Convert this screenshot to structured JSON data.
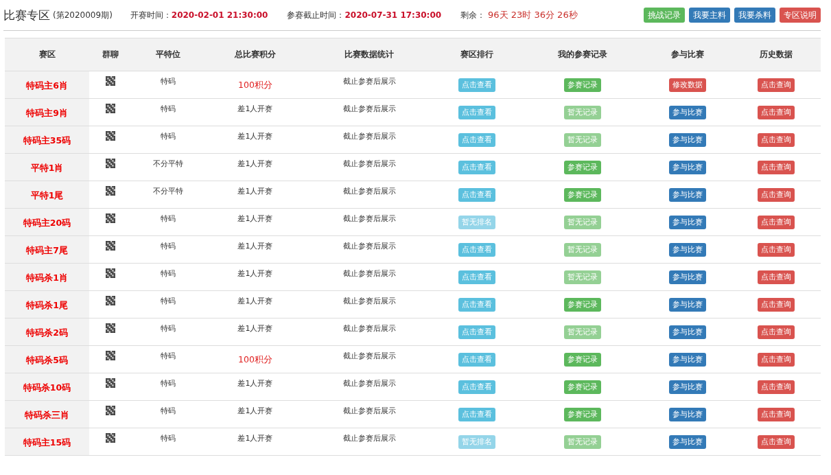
{
  "header": {
    "title": "比赛专区",
    "period": "(第2020009期)",
    "start_label": "开赛时间：",
    "start_value": "2020-02-01 21:30:00",
    "deadline_label": "参赛截止时间：",
    "deadline_value": "2020-07-31 17:30:00",
    "remaining_label": "剩余：",
    "remaining_value": "96天 23时 36分 26秒",
    "buttons": [
      {
        "label": "挑战记录",
        "kind": "success"
      },
      {
        "label": "我要主料",
        "kind": "primary"
      },
      {
        "label": "我要杀料",
        "kind": "primary"
      },
      {
        "label": "专区说明",
        "kind": "danger"
      }
    ]
  },
  "table": {
    "columns": [
      "赛区",
      "群聊",
      "平特位",
      "总比赛积分",
      "比赛数据统计",
      "赛区排行",
      "我的参赛记录",
      "参与比赛",
      "历史数据"
    ],
    "rows": [
      {
        "zone": "特码主6肖",
        "position": "特码",
        "score": "100积分",
        "score_highlight": true,
        "stats": "截止参赛后展示",
        "rank": {
          "label": "点击查看",
          "disabled": false
        },
        "record": {
          "label": "参赛记录",
          "disabled": false
        },
        "join": {
          "label": "修改数据",
          "kind": "modify"
        },
        "history": "点击查询"
      },
      {
        "zone": "特码主9肖",
        "position": "特码",
        "score": "差1人开赛",
        "score_highlight": false,
        "stats": "截止参赛后展示",
        "rank": {
          "label": "点击查看",
          "disabled": false
        },
        "record": {
          "label": "暂无记录",
          "disabled": true
        },
        "join": {
          "label": "参与比赛",
          "kind": "join"
        },
        "history": "点击查询"
      },
      {
        "zone": "特码主35码",
        "position": "特码",
        "score": "差1人开赛",
        "score_highlight": false,
        "stats": "截止参赛后展示",
        "rank": {
          "label": "点击查看",
          "disabled": false
        },
        "record": {
          "label": "暂无记录",
          "disabled": true
        },
        "join": {
          "label": "参与比赛",
          "kind": "join"
        },
        "history": "点击查询"
      },
      {
        "zone": "平特1肖",
        "position": "不分平特",
        "score": "差1人开赛",
        "score_highlight": false,
        "stats": "截止参赛后展示",
        "rank": {
          "label": "点击查看",
          "disabled": false
        },
        "record": {
          "label": "参赛记录",
          "disabled": false
        },
        "join": {
          "label": "参与比赛",
          "kind": "join"
        },
        "history": "点击查询"
      },
      {
        "zone": "平特1尾",
        "position": "不分平特",
        "score": "差1人开赛",
        "score_highlight": false,
        "stats": "截止参赛后展示",
        "rank": {
          "label": "点击查看",
          "disabled": false
        },
        "record": {
          "label": "参赛记录",
          "disabled": false
        },
        "join": {
          "label": "参与比赛",
          "kind": "join"
        },
        "history": "点击查询"
      },
      {
        "zone": "特码主20码",
        "position": "特码",
        "score": "差1人开赛",
        "score_highlight": false,
        "stats": "截止参赛后展示",
        "rank": {
          "label": "暂无排名",
          "disabled": true
        },
        "record": {
          "label": "暂无记录",
          "disabled": true
        },
        "join": {
          "label": "参与比赛",
          "kind": "join"
        },
        "history": "点击查询"
      },
      {
        "zone": "特码主7尾",
        "position": "特码",
        "score": "差1人开赛",
        "score_highlight": false,
        "stats": "截止参赛后展示",
        "rank": {
          "label": "点击查看",
          "disabled": false
        },
        "record": {
          "label": "暂无记录",
          "disabled": true
        },
        "join": {
          "label": "参与比赛",
          "kind": "join"
        },
        "history": "点击查询"
      },
      {
        "zone": "特码杀1肖",
        "position": "特码",
        "score": "差1人开赛",
        "score_highlight": false,
        "stats": "截止参赛后展示",
        "rank": {
          "label": "点击查看",
          "disabled": false
        },
        "record": {
          "label": "暂无记录",
          "disabled": true
        },
        "join": {
          "label": "参与比赛",
          "kind": "join"
        },
        "history": "点击查询"
      },
      {
        "zone": "特码杀1尾",
        "position": "特码",
        "score": "差1人开赛",
        "score_highlight": false,
        "stats": "截止参赛后展示",
        "rank": {
          "label": "点击查看",
          "disabled": false
        },
        "record": {
          "label": "参赛记录",
          "disabled": false
        },
        "join": {
          "label": "参与比赛",
          "kind": "join"
        },
        "history": "点击查询"
      },
      {
        "zone": "特码杀2码",
        "position": "特码",
        "score": "差1人开赛",
        "score_highlight": false,
        "stats": "截止参赛后展示",
        "rank": {
          "label": "点击查看",
          "disabled": false
        },
        "record": {
          "label": "暂无记录",
          "disabled": true
        },
        "join": {
          "label": "参与比赛",
          "kind": "join"
        },
        "history": "点击查询"
      },
      {
        "zone": "特码杀5码",
        "position": "特码",
        "score": "100积分",
        "score_highlight": true,
        "stats": "截止参赛后展示",
        "rank": {
          "label": "点击查看",
          "disabled": false
        },
        "record": {
          "label": "参赛记录",
          "disabled": false
        },
        "join": {
          "label": "参与比赛",
          "kind": "join"
        },
        "history": "点击查询"
      },
      {
        "zone": "特码杀10码",
        "position": "特码",
        "score": "差1人开赛",
        "score_highlight": false,
        "stats": "截止参赛后展示",
        "rank": {
          "label": "点击查看",
          "disabled": false
        },
        "record": {
          "label": "参赛记录",
          "disabled": false
        },
        "join": {
          "label": "参与比赛",
          "kind": "join"
        },
        "history": "点击查询"
      },
      {
        "zone": "特码杀三肖",
        "position": "特码",
        "score": "差1人开赛",
        "score_highlight": false,
        "stats": "截止参赛后展示",
        "rank": {
          "label": "点击查看",
          "disabled": false
        },
        "record": {
          "label": "参赛记录",
          "disabled": false
        },
        "join": {
          "label": "参与比赛",
          "kind": "join"
        },
        "history": "点击查询"
      },
      {
        "zone": "特码主15码",
        "position": "特码",
        "score": "差1人开赛",
        "score_highlight": false,
        "stats": "截止参赛后展示",
        "rank": {
          "label": "暂无排名",
          "disabled": true
        },
        "record": {
          "label": "暂无记录",
          "disabled": true
        },
        "join": {
          "label": "参与比赛",
          "kind": "join"
        },
        "history": "点击查询"
      }
    ]
  }
}
